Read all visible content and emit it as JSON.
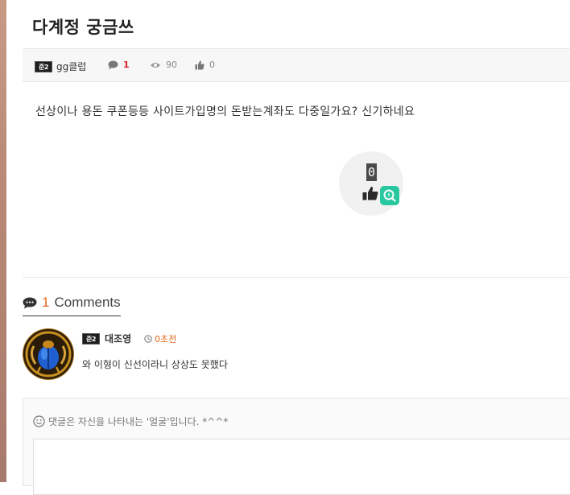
{
  "post": {
    "title": "다계정 궁금쓰",
    "content": "선상이나 용돈 쿠폰등등 사이트가입명의 돈받는계좌도 다중일가요? 신기하네요"
  },
  "meta": {
    "author": "gg클럽",
    "level_badge": "준2",
    "comment_count": "1",
    "views": "90",
    "likes": "0"
  },
  "vote": {
    "count": "0"
  },
  "comments": {
    "count": "1",
    "label": "Comments",
    "items": [
      {
        "author": "대조영",
        "level_badge": "준2",
        "time": "0초전",
        "text": "와 이형이 신선이라니 상상도 못했다"
      }
    ]
  },
  "reply": {
    "hint": "댓글은 자신을 나타내는 '얼굴'입니다. *^^*"
  },
  "icons": {
    "comment": "comment-icon",
    "eye": "eye-icon",
    "thumbs_up": "thumbs-up-icon",
    "clock": "clock-icon",
    "smile": "smile-icon",
    "quick": "search-bolt-icon"
  },
  "colors": {
    "accent_orange": "#e6671e",
    "accent_red": "#e0202a",
    "quick_green": "#27c7a0"
  }
}
